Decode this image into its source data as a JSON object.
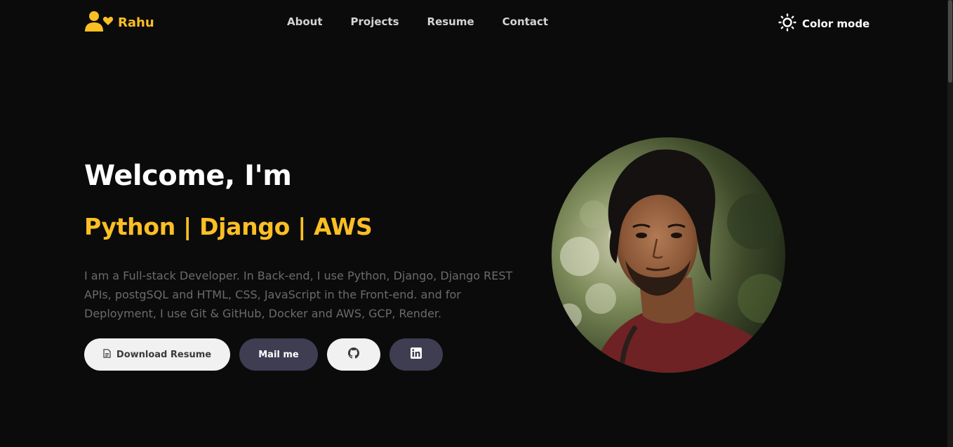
{
  "header": {
    "logo_text": "Rahu",
    "nav": [
      "About",
      "Projects",
      "Resume",
      "Contact"
    ],
    "color_mode_label": "Color mode"
  },
  "hero": {
    "greeting": "Welcome, I'm",
    "skills": "Python | Django | AWS",
    "description": "I am a Full-stack Developer. In Back-end, I use Python, Django, Django REST APIs, postgSQL and HTML, CSS, JavaScript in the Front-end. and for Deployment, I use Git & GitHub, Docker and AWS, GCP, Render."
  },
  "buttons": {
    "download_resume": "Download Resume",
    "mail_me": "Mail me"
  },
  "icons": {
    "logo": "user-heart-icon",
    "color_mode": "sun-icon",
    "download": "file-icon",
    "github": "github-icon",
    "linkedin": "linkedin-icon"
  },
  "colors": {
    "accent": "#fbbf24",
    "background": "#0b0b0b",
    "button_dark": "#3f3d52",
    "button_light": "#f1f1f1"
  }
}
